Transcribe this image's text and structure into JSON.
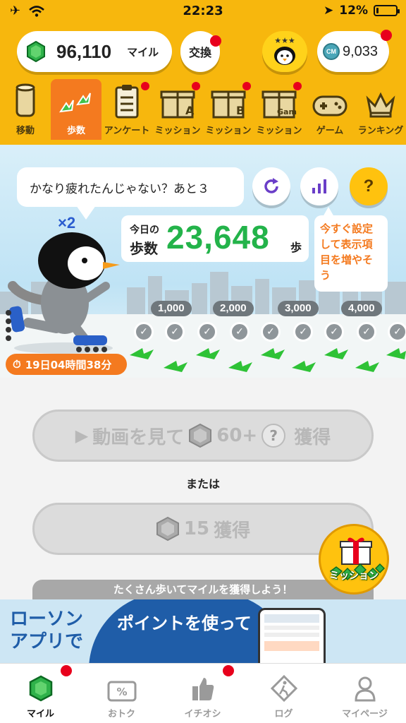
{
  "status_bar": {
    "time": "22:23",
    "battery": "12%",
    "battery_level": 0.12
  },
  "header": {
    "miles_value": "96,110",
    "miles_unit": "マイル",
    "exchange_label": "交換",
    "coins_value": "9,033",
    "coin_mark": "CM"
  },
  "nav": {
    "items": [
      {
        "label": "移動",
        "icon": "can-icon"
      },
      {
        "label": "歩数",
        "icon": "footprints-icon"
      },
      {
        "label": "アンケート",
        "icon": "clipboard-icon"
      },
      {
        "label": "ミッション",
        "icon": "gift-a-icon",
        "mark": "A"
      },
      {
        "label": "ミッション",
        "icon": "gift-b-icon",
        "mark": "B"
      },
      {
        "label": "ミッション",
        "icon": "gift-game-icon",
        "mark": "Game"
      },
      {
        "label": "ゲーム",
        "icon": "gamepad-icon"
      },
      {
        "label": "ランキング",
        "icon": "crown-icon"
      }
    ]
  },
  "scene": {
    "speech": "かなり疲れたんじゃない？あと３",
    "multiplier": "×2",
    "today_label": "今日の",
    "steps_label": "歩数",
    "steps_value": "23,648",
    "steps_unit": "歩",
    "tip": "今すぐ設定して表示項目を増やそう",
    "help": "?",
    "milestones": [
      "1,000",
      "2,000",
      "3,000",
      "4,000"
    ],
    "timer": "19日04時間38分"
  },
  "main": {
    "video_btn_prefix": "動画を見て",
    "video_btn_amount": "60+",
    "video_btn_suffix": "獲得",
    "or_text": "または",
    "get_btn_amount": "15",
    "get_btn_suffix": "獲得",
    "strip_text": "たくさん歩いてマイルを獲得しよう！",
    "mission_label": "ミッション"
  },
  "ad": {
    "left_line1": "ローソン",
    "left_line2": "アプリで",
    "mid_text": "ポイントを使って"
  },
  "tabbar": {
    "items": [
      {
        "label": "マイル",
        "icon": "gem-icon"
      },
      {
        "label": "おトク",
        "icon": "percent-ticket-icon"
      },
      {
        "label": "イチオシ",
        "icon": "thumbs-up-icon"
      },
      {
        "label": "ログ",
        "icon": "walker-sign-icon"
      },
      {
        "label": "マイページ",
        "icon": "person-icon"
      }
    ]
  },
  "colors": {
    "header": "#f7b70d",
    "accent": "#f47a1f",
    "steps_green": "#23b34a",
    "badge_red": "#e8001c"
  }
}
